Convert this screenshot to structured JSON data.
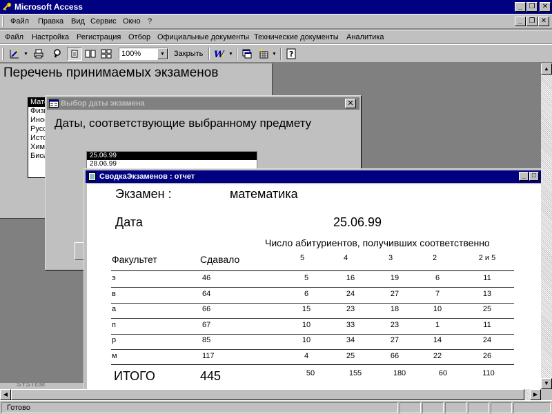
{
  "app": {
    "title": "Microsoft Access"
  },
  "menu_main": [
    "Файл",
    "Правка",
    "Вид",
    "Сервис",
    "Окно",
    "?"
  ],
  "menu_custom": [
    "Файл",
    "Настройка",
    "Регистрация",
    "Отбор",
    "Официальные документы",
    "Технические документы",
    "Аналитика"
  ],
  "toolbar": {
    "zoom": "100%",
    "close_label": "Закрыть"
  },
  "form1": {
    "title": "Перечень принимаемых экзаменов",
    "subjects": [
      "Математика",
      "Физика",
      "Иностранный",
      "Русский",
      "История",
      "Химия",
      "Биология"
    ]
  },
  "form2": {
    "caption": "Выбор даты экзамена",
    "heading": "Даты, соответствующие выбранному предмету",
    "dates": [
      "25.06.99",
      "28.06.99"
    ]
  },
  "report": {
    "caption": "СводкаЭкзаменов : отчет",
    "exam_label": "Экзамен :",
    "exam_value": "математика",
    "date_label": "Дата",
    "date_value": "25.06.99",
    "subheader": "Число абитуриентов, получивших соответственно",
    "col_faculty": "Факультет",
    "col_taken": "Сдавало",
    "grades": [
      "5",
      "4",
      "3",
      "2",
      "2 и 5"
    ],
    "rows": [
      {
        "faculty": "э",
        "taken": "46",
        "g5": "5",
        "g4": "16",
        "g3": "19",
        "g2": "6",
        "g25": "11"
      },
      {
        "faculty": "в",
        "taken": "64",
        "g5": "6",
        "g4": "24",
        "g3": "27",
        "g2": "7",
        "g25": "13"
      },
      {
        "faculty": "а",
        "taken": "66",
        "g5": "15",
        "g4": "23",
        "g3": "18",
        "g2": "10",
        "g25": "25"
      },
      {
        "faculty": "п",
        "taken": "67",
        "g5": "10",
        "g4": "33",
        "g3": "23",
        "g2": "1",
        "g25": "11"
      },
      {
        "faculty": "р",
        "taken": "85",
        "g5": "10",
        "g4": "34",
        "g3": "27",
        "g2": "14",
        "g25": "24"
      },
      {
        "faculty": "м",
        "taken": "117",
        "g5": "4",
        "g4": "25",
        "g3": "66",
        "g2": "22",
        "g25": "26"
      }
    ],
    "total": {
      "label": "ИТОГО",
      "taken": "445",
      "g5": "50",
      "g4": "155",
      "g3": "180",
      "g2": "60",
      "g25": "110"
    }
  },
  "minimized_window": "SYSTEM",
  "status": {
    "text": "Готово"
  }
}
